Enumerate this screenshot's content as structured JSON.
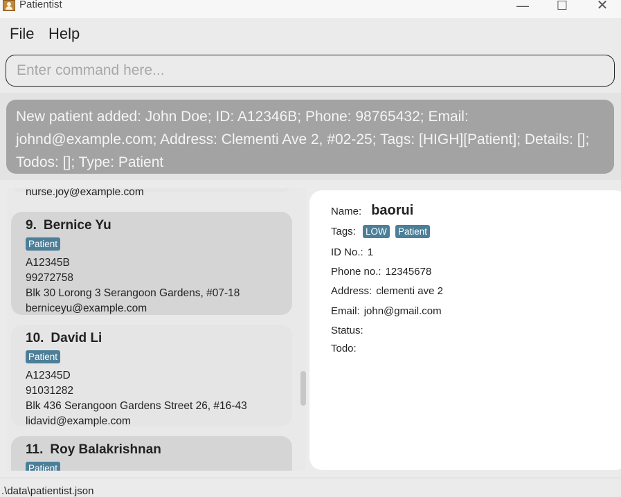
{
  "window": {
    "title": "Patientist",
    "minimize_glyph": "—",
    "maximize_glyph": "☐",
    "close_glyph": "✕"
  },
  "menu": {
    "file": "File",
    "help": "Help"
  },
  "command": {
    "placeholder": "Enter command here...",
    "value": ""
  },
  "result": {
    "text": "New patient added: John Doe; ID: A12346B; Phone: 98765432; Email: johnd@example.com; Address: Clementi Ave 2, #02-25; Tags: [HIGH][Patient]; Details: []; Todos: []; Type: Patient"
  },
  "patient_list": {
    "partial_top_email": "nurse.joy@example.com",
    "cards": [
      {
        "index": "9.",
        "name": "Bernice Yu",
        "tags": [
          "Patient"
        ],
        "id": "A12345B",
        "phone": "99272758",
        "address": "Blk 30 Lorong 3 Serangoon Gardens, #07-18",
        "email": "berniceyu@example.com"
      },
      {
        "index": "10.",
        "name": "David Li",
        "tags": [
          "Patient"
        ],
        "id": "A12345D",
        "phone": "91031282",
        "address": "Blk 436 Serangoon Gardens Street 26, #16-43",
        "email": "lidavid@example.com"
      },
      {
        "index": "11.",
        "name": "Roy Balakrishnan",
        "tags": [
          "Patient"
        ]
      }
    ]
  },
  "detail": {
    "name_label": "Name:",
    "name_value": "baorui",
    "tags_label": "Tags:",
    "tags": [
      "LOW",
      "Patient"
    ],
    "id_label": "ID No.:",
    "id_value": "1",
    "phone_label": "Phone no.:",
    "phone_value": "12345678",
    "address_label": "Address:",
    "address_value": "clementi ave 2",
    "email_label": "Email:",
    "email_value": "john@gmail.com",
    "status_label": "Status:",
    "todo_label": "Todo:"
  },
  "status_bar": {
    "path": ".\\data\\patientist.json"
  },
  "colors": {
    "tag": "#4d7f98",
    "result_bg": "#a3a3a3",
    "card_dark": "#d5d5d5",
    "card_light": "#e5e5e5"
  }
}
